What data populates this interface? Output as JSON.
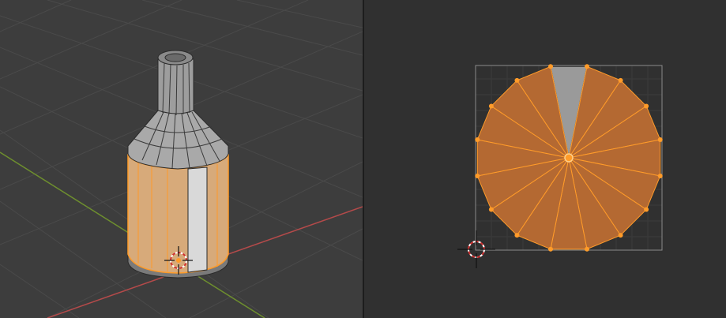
{
  "theme": {
    "viewport_bg": "#3d3d3d",
    "uv_bg": "#303030",
    "selection": "#ff9b29",
    "face_fill": "#b46932",
    "mesh_gray": "#9a9a9a",
    "x_axis": "#b44a4a",
    "y_axis": "#6e8f2e"
  },
  "viewport_3d": {
    "object": "bottle-mesh",
    "mode": "edit-mode-face-select",
    "selected_band": "lower-cylinder-faces"
  },
  "uv_editor": {
    "island": "cap-circle-16-segment",
    "segments": 16,
    "unselected_segments": 1
  }
}
